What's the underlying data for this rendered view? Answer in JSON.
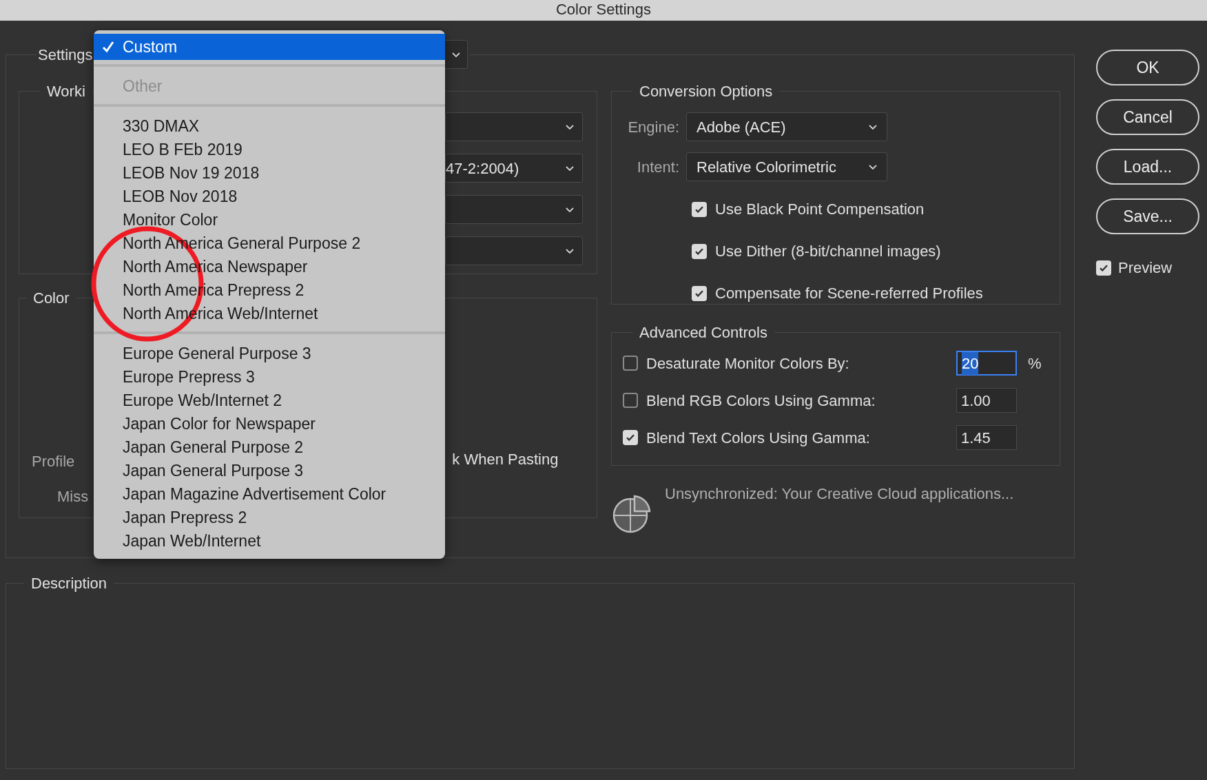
{
  "window": {
    "title": "Color Settings"
  },
  "settings": {
    "label": "Settings",
    "menu": {
      "sections": [
        [
          {
            "label": "Custom",
            "selected": true,
            "disabled": false
          }
        ],
        [
          {
            "label": "Other",
            "selected": false,
            "disabled": true
          }
        ],
        [
          {
            "label": "330 DMAX",
            "selected": false,
            "disabled": false
          },
          {
            "label": "LEO B FEb 2019",
            "selected": false,
            "disabled": false
          },
          {
            "label": "LEOB Nov 19 2018",
            "selected": false,
            "disabled": false
          },
          {
            "label": "LEOB Nov 2018",
            "selected": false,
            "disabled": false
          },
          {
            "label": "Monitor Color",
            "selected": false,
            "disabled": false
          },
          {
            "label": "North America General Purpose 2",
            "selected": false,
            "disabled": false
          },
          {
            "label": "North America Newspaper",
            "selected": false,
            "disabled": false
          },
          {
            "label": "North America Prepress 2",
            "selected": false,
            "disabled": false
          },
          {
            "label": "North America Web/Internet",
            "selected": false,
            "disabled": false
          }
        ],
        [
          {
            "label": "Europe General Purpose 3",
            "selected": false,
            "disabled": false
          },
          {
            "label": "Europe Prepress 3",
            "selected": false,
            "disabled": false
          },
          {
            "label": "Europe Web/Internet 2",
            "selected": false,
            "disabled": false
          },
          {
            "label": "Japan Color for Newspaper",
            "selected": false,
            "disabled": false
          },
          {
            "label": "Japan General Purpose 2",
            "selected": false,
            "disabled": false
          },
          {
            "label": "Japan General Purpose 3",
            "selected": false,
            "disabled": false
          },
          {
            "label": "Japan Magazine Advertisement Color",
            "selected": false,
            "disabled": false
          },
          {
            "label": "Japan Prepress 2",
            "selected": false,
            "disabled": false
          },
          {
            "label": "Japan Web/Internet",
            "selected": false,
            "disabled": false
          }
        ]
      ]
    }
  },
  "working_spaces": {
    "label": "Worki",
    "dropdowns": [
      {
        "kind": "select"
      },
      {
        "kind": "select",
        "value": "47-2:2004)"
      },
      {
        "kind": "select"
      },
      {
        "kind": "select"
      }
    ]
  },
  "color_management": {
    "label": "Color",
    "profile_label": "Profile",
    "missing_label": "Miss",
    "paste_label": "k When Pasting"
  },
  "conversion_options": {
    "label": "Conversion Options",
    "engine": {
      "label": "Engine:",
      "value": "Adobe (ACE)"
    },
    "intent": {
      "label": "Intent:",
      "value": "Relative Colorimetric"
    },
    "checkboxes": [
      {
        "label": "Use Black Point Compensation",
        "checked": true
      },
      {
        "label": "Use Dither (8-bit/channel images)",
        "checked": true
      },
      {
        "label": "Compensate for Scene-referred Profiles",
        "checked": true
      }
    ]
  },
  "advanced_controls": {
    "label": "Advanced Controls",
    "rows": [
      {
        "label": "Desaturate Monitor Colors By:",
        "checked": false,
        "value": "20",
        "focused": true,
        "unit": "%"
      },
      {
        "label": "Blend RGB Colors Using Gamma:",
        "checked": false,
        "value": "1.00",
        "focused": false
      },
      {
        "label": "Blend Text Colors Using Gamma:",
        "checked": true,
        "value": "1.45",
        "focused": false
      }
    ]
  },
  "sync": {
    "message": "Unsynchronized: Your Creative Cloud applications..."
  },
  "buttons": [
    {
      "label": "OK"
    },
    {
      "label": "Cancel"
    },
    {
      "label": "Load..."
    },
    {
      "label": "Save..."
    }
  ],
  "preview": {
    "label": "Preview",
    "checked": true
  },
  "description": {
    "label": "Description"
  }
}
